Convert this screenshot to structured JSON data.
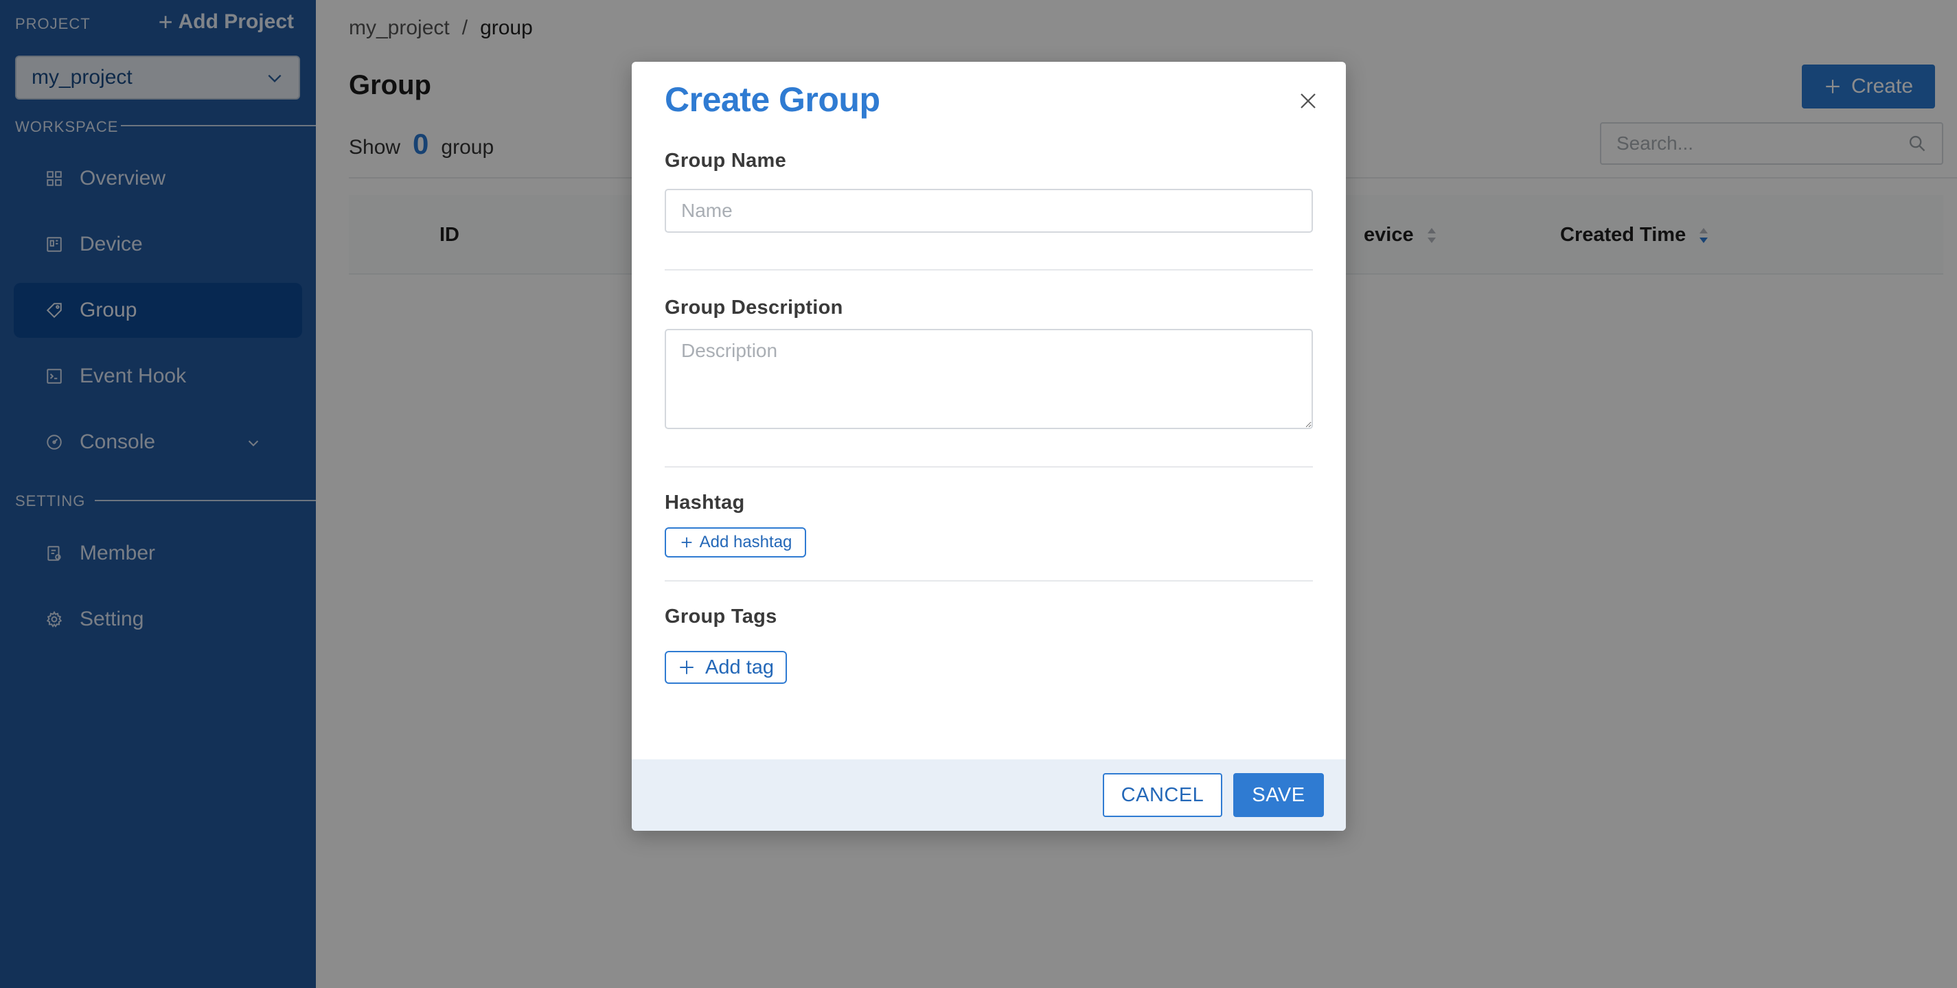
{
  "sidebar": {
    "project_heading": "PROJECT",
    "add_project_label": "Add Project",
    "selected_project": "my_project",
    "workspace_heading": "WORKSPACE",
    "setting_heading": "SETTING",
    "items": [
      {
        "label": "Overview",
        "icon": "grid-icon"
      },
      {
        "label": "Device",
        "icon": "device-icon"
      },
      {
        "label": "Group",
        "icon": "tag-icon",
        "active": true
      },
      {
        "label": "Event Hook",
        "icon": "terminal-icon"
      },
      {
        "label": "Console",
        "icon": "gauge-icon",
        "expandable": true
      },
      {
        "label": "Member",
        "icon": "member-icon"
      },
      {
        "label": "Setting",
        "icon": "gear-icon"
      }
    ]
  },
  "main": {
    "breadcrumb": {
      "root": "my_project",
      "separator": "/",
      "current": "group"
    },
    "title": "Group",
    "show_prefix": "Show",
    "show_count": "0",
    "show_suffix": "group",
    "create_label": "Create",
    "search_placeholder": "Search...",
    "table": {
      "columns": [
        "ID",
        "evice",
        "Created Time"
      ]
    }
  },
  "modal": {
    "title": "Create Group",
    "group_name_label": "Group Name",
    "group_name_placeholder": "Name",
    "group_name_value": "",
    "description_label": "Group Description",
    "description_placeholder": "Description",
    "description_value": "",
    "hashtag_label": "Hashtag",
    "add_hashtag_label": "Add hashtag",
    "tags_label": "Group Tags",
    "add_tag_label": "Add tag",
    "cancel_label": "CANCEL",
    "save_label": "SAVE"
  },
  "colors": {
    "sidebar_bg": "#23599f",
    "sidebar_active": "#0d4a94",
    "accent": "#2f7bd2",
    "overlay": "rgba(0,0,0,0.45)"
  }
}
